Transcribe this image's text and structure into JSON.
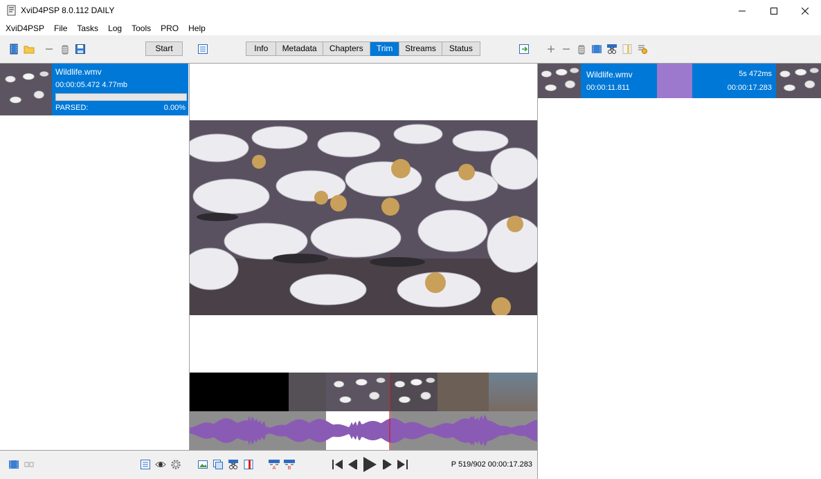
{
  "window": {
    "title": "XviD4PSP 8.0.112 DAILY",
    "minimize": "—",
    "maximize": "☐",
    "close": "✕"
  },
  "menu": [
    "XviD4PSP",
    "File",
    "Tasks",
    "Log",
    "Tools",
    "PRO",
    "Help"
  ],
  "left": {
    "start_label": "Start",
    "file": {
      "name": "Wildlife.wmv",
      "info": "00:00:05.472 4.77mb",
      "status": "PARSED:",
      "percent": "0.00%",
      "progress": 0.0
    }
  },
  "center": {
    "tabs": [
      "Info",
      "Metadata",
      "Chapters",
      "Trim",
      "Streams",
      "Status"
    ],
    "active_tab": "Trim",
    "position": "P 519/902 00:00:17.283"
  },
  "right": {
    "segment": {
      "name": "Wildlife.wmv",
      "start": "00:00:11.811",
      "duration": "5s 472ms",
      "end": "00:00:17.283"
    }
  },
  "colors": {
    "accent": "#0078d7",
    "segment_mark": "#9c79cd",
    "waveform": "#8a5bb5",
    "playhead": "#d11a1a"
  }
}
